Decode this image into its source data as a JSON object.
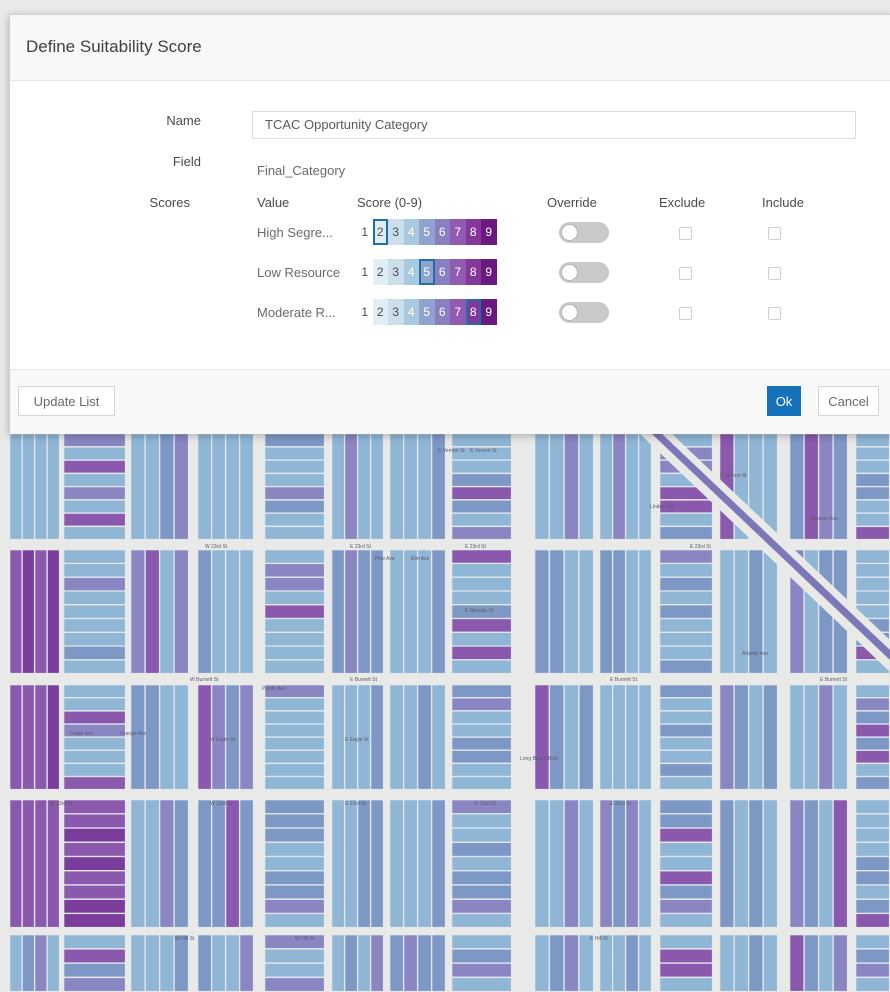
{
  "dialog": {
    "title": "Define Suitability Score",
    "name_label": "Name",
    "name_value": "TCAC Opportunity Category",
    "field_label": "Field",
    "field_value": "Final_Category",
    "scores_label": "Scores",
    "columns": {
      "value": "Value",
      "score": "Score (0-9)",
      "override": "Override",
      "exclude": "Exclude",
      "include": "Include"
    },
    "rows": [
      {
        "value": "High Segre...",
        "score": 2,
        "override": false,
        "exclude": false,
        "include": false
      },
      {
        "value": "Low Resource",
        "score": 5,
        "override": false,
        "exclude": false,
        "include": false
      },
      {
        "value": "Moderate R...",
        "score": 8,
        "override": false,
        "exclude": false,
        "include": false
      }
    ],
    "scale_labels": [
      "1",
      "2",
      "3",
      "4",
      "5",
      "6",
      "7",
      "8",
      "9"
    ],
    "scale_colors": [
      "#ffffff",
      "#e3eef4",
      "#cadeeb",
      "#a9c9de",
      "#8ea4cf",
      "#8a7fc1",
      "#8f5bb0",
      "#85369b",
      "#6a1a7f"
    ],
    "buttons": {
      "update_list": "Update List",
      "ok": "Ok",
      "cancel": "Cancel"
    }
  },
  "map": {
    "street_labels": [
      "E Vernon St",
      "E Vernon St",
      "W 23rd St",
      "E 23rd St",
      "E 23rd St",
      "E Vernon St",
      "E 23rd St",
      "E Nevada St",
      "W Burnett St",
      "E Burnett St",
      "E Burnett St",
      "E Burnett St",
      "W Eagle St",
      "E Eagle St",
      "W 23rd St",
      "W 23rd St",
      "E 23rd St",
      "E 23rd St",
      "E 23rd St",
      "W Hill St",
      "W Hill St",
      "E Hill St",
      "Pacific Ave",
      "Pine Ave",
      "Elm Ave",
      "Linden Ave",
      "Long Beach Blvd",
      "Atlantic Ave",
      "Cedar Ave",
      "Orange Ave",
      "Dawson Ave"
    ],
    "colors": {
      "street": "#e9e9e7",
      "light_blue": "#8fb6d5",
      "mid_blue": "#7e98c6",
      "periwinkle": "#8a86c2",
      "purple": "#8a58ad",
      "dark_purple": "#7b3d9c"
    }
  }
}
